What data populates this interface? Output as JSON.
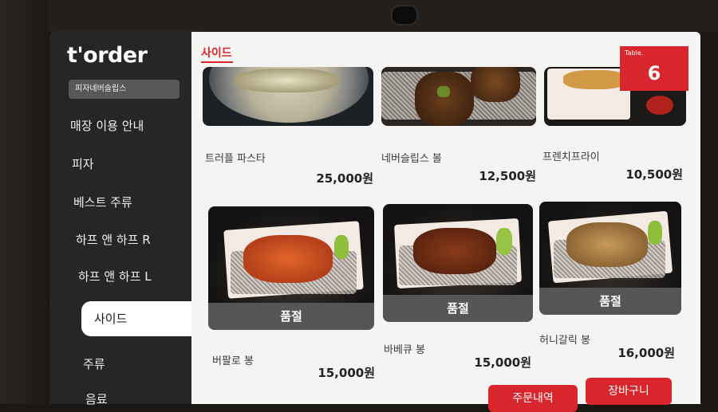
{
  "app": {
    "logo": "t'order",
    "store_name": "피자네버슬립스"
  },
  "categories": [
    {
      "label": "매장 이용 안내"
    },
    {
      "label": "피자"
    },
    {
      "label": "베스트 주류"
    },
    {
      "label": "하프 앤 하프 R"
    },
    {
      "label": "하프 앤 하프 L"
    },
    {
      "label": "사이드",
      "active": true
    },
    {
      "label": "주류"
    },
    {
      "label": "음료"
    }
  ],
  "section": {
    "title": "사이드"
  },
  "table": {
    "label": "Table.",
    "number": "6"
  },
  "menu_items": [
    {
      "name": "트러플 파스타",
      "price": "25,000원",
      "sold_out": false
    },
    {
      "name": "네버슬립스 볼",
      "price": "12,500원",
      "sold_out": false
    },
    {
      "name": "프렌치프라이",
      "price": "10,500원",
      "sold_out": false
    },
    {
      "name": "버팔로 봉",
      "price": "15,000원",
      "sold_out": true,
      "sold_out_label": "품절"
    },
    {
      "name": "바베큐 봉",
      "price": "15,000원",
      "sold_out": true,
      "sold_out_label": "품절"
    },
    {
      "name": "허니갈릭 봉",
      "price": "16,000원",
      "sold_out": true,
      "sold_out_label": "품절"
    }
  ],
  "buttons": {
    "order_history": "주문내역",
    "cart": "장바구니"
  },
  "colors": {
    "accent": "#d9262c",
    "sidebar": "#272626",
    "content_bg": "#f4f4f3",
    "soldout_overlay": "#5a5a5a"
  }
}
